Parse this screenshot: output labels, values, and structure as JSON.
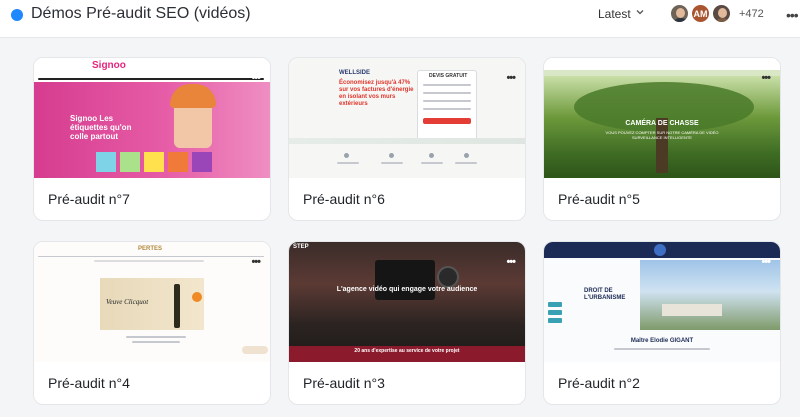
{
  "header": {
    "title": "Démos Pré-audit SEO (vidéos)",
    "sort_label": "Latest",
    "avatars": [
      {
        "initials": "",
        "icon": "user-photo"
      },
      {
        "initials": "AM",
        "icon": ""
      },
      {
        "initials": "",
        "icon": "user-photo"
      }
    ],
    "more_count": "+472",
    "menu_icon": "more-horizontal-icon",
    "accent": "#1e88ff"
  },
  "cards": [
    {
      "label": "Pré-audit n°7",
      "thumb": {
        "logo": "Signoo",
        "headline": "Signoo Les étiquettes qu'on colle partout"
      }
    },
    {
      "label": "Pré-audit n°6",
      "thumb": {
        "logo": "WELLSIDE",
        "headline": "Économisez jusqu'à 47% sur vos factures d'énergie en isolant vos murs extérieurs",
        "form_title": "DEVIS GRATUIT"
      }
    },
    {
      "label": "Pré-audit n°5",
      "thumb": {
        "headline": "CAMÉRA DE CHASSE",
        "sub": "VOUS POUVEZ COMPTER SUR NOTRE CAMÉRA DE VIDÉO SURVEILLANCE INTELLIGENTE"
      }
    },
    {
      "label": "Pré-audit n°4",
      "thumb": {
        "logo": "PERTES",
        "headline": "Veuve Clicquot"
      }
    },
    {
      "label": "Pré-audit n°3",
      "thumb": {
        "logo": "STEP",
        "headline": "L'agence vidéo qui engage votre audience",
        "footer": "20 ans d'expertise au service de votre projet"
      }
    },
    {
      "label": "Pré-audit n°2",
      "thumb": {
        "headline": "DROIT DE L'URBANISME",
        "name": "Maître Elodie GIGANT"
      }
    }
  ]
}
